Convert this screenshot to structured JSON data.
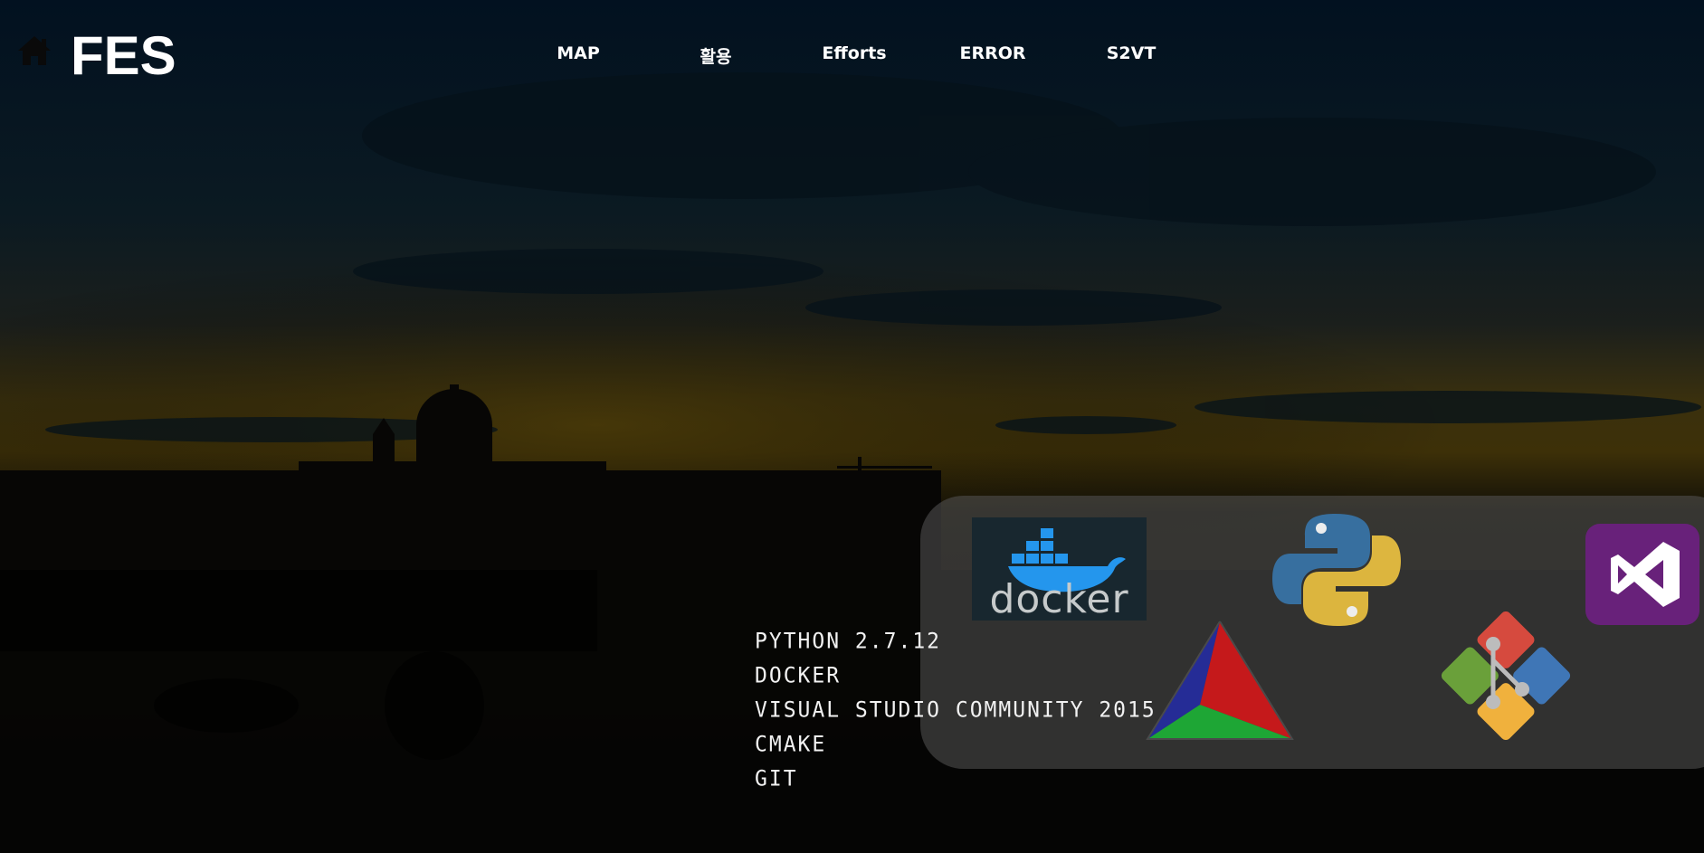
{
  "site": {
    "title": "FES"
  },
  "icons": {
    "home": "home-icon"
  },
  "nav": {
    "items": [
      {
        "label": "MAP"
      },
      {
        "label": "활용"
      },
      {
        "label": "Efforts"
      },
      {
        "label": "ERROR"
      },
      {
        "label": "S2VT"
      }
    ]
  },
  "tech_stack": {
    "items": [
      "PYTHON 2.7.12",
      "DOCKER",
      "VISUAL STUDIO COMMUNITY 2015",
      "CMAKE",
      "GIT"
    ],
    "logos": [
      {
        "name": "docker-logo",
        "text": "docker"
      },
      {
        "name": "python-logo"
      },
      {
        "name": "visual-studio-logo"
      },
      {
        "name": "cmake-logo"
      },
      {
        "name": "git-logo"
      }
    ]
  },
  "colors": {
    "background_top": "#04131f",
    "background_horizon": "#4a3a0a",
    "nav_text": "#ffffff",
    "panel": "#555555",
    "docker_blue": "#2496ed",
    "python_blue": "#376f9f",
    "python_yellow": "#f7c948",
    "vs_purple": "#68217a"
  }
}
